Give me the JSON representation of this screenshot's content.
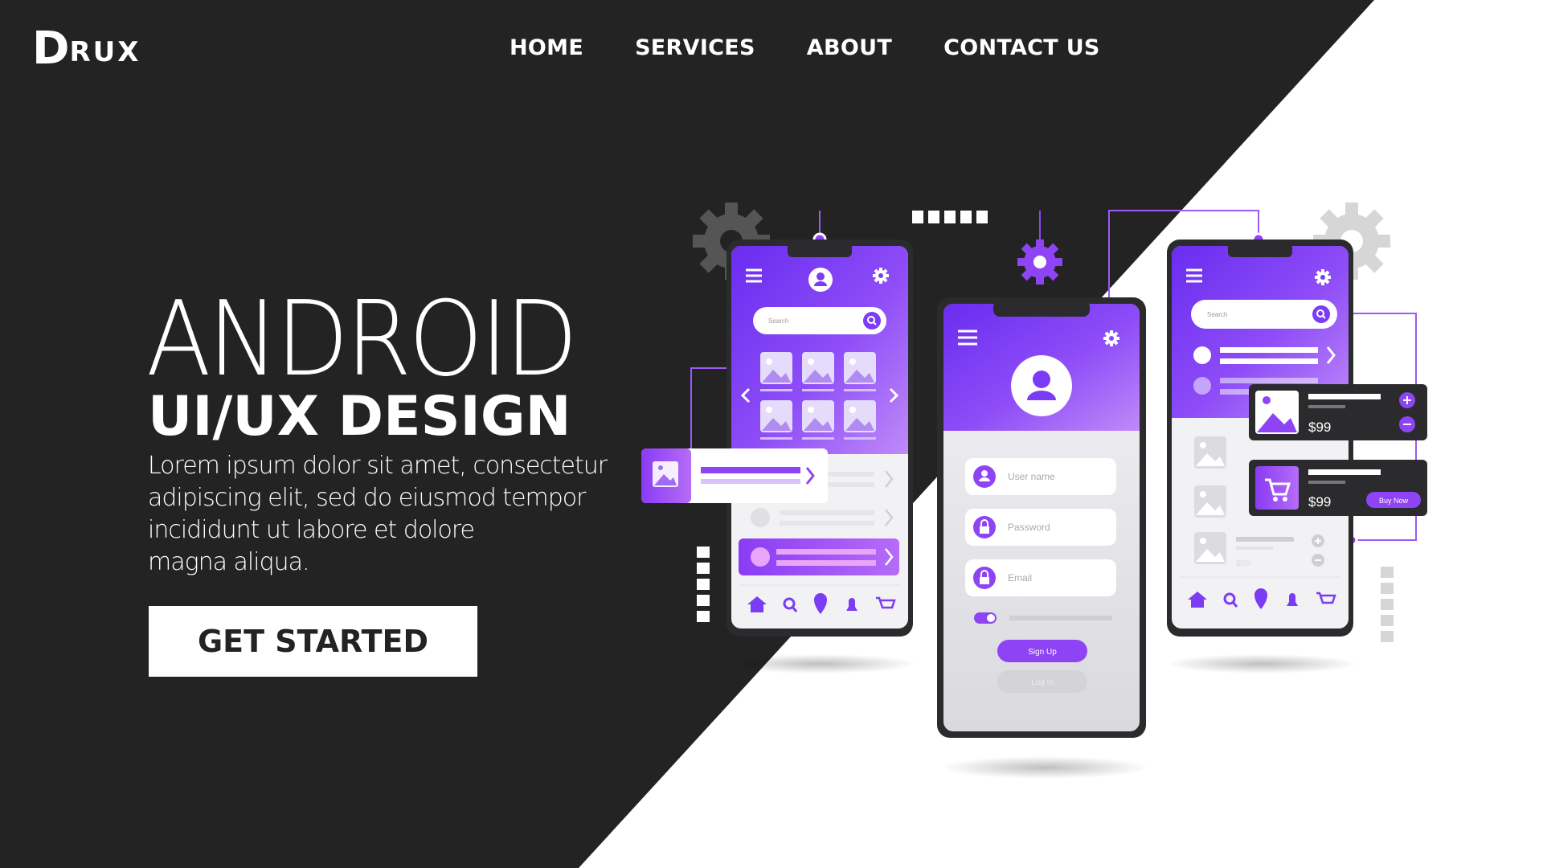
{
  "brand": {
    "logo_initial": "D",
    "logo_rest": "RUX"
  },
  "nav": {
    "items": [
      "HOME",
      "SERVICES",
      "ABOUT",
      "CONTACT US"
    ]
  },
  "hero": {
    "title": "ANDROID",
    "subtitle": "UI/UX DESIGN",
    "body_lines": [
      "Lorem ipsum dolor sit amet, consectetur",
      "adipiscing elit, sed do eiusmod tempor",
      "incididunt ut labore et dolore",
      "magna aliqua."
    ],
    "cta": "GET STARTED"
  },
  "phones": {
    "left": {
      "search_placeholder": "Search"
    },
    "middle": {
      "username_placeholder": "User name",
      "password_placeholder": "Password",
      "email_placeholder": "Email",
      "signup_label": "Sign Up",
      "login_label": "Log In"
    },
    "right": {
      "search_placeholder": "Search",
      "card1_price": "$99",
      "card2_price": "$99",
      "buy_label": "Buy Now",
      "list_price": "$99"
    }
  },
  "colors": {
    "dark": "#232323",
    "accent": "#7b3cf5",
    "accent_light": "#b56cf7",
    "white": "#ffffff"
  },
  "icons": [
    "menu-icon",
    "user-icon",
    "gear-icon",
    "search-icon",
    "image-icon",
    "chevron-right-icon",
    "chevron-left-icon",
    "home-icon",
    "location-icon",
    "bell-icon",
    "cart-icon",
    "lock-icon",
    "plus-icon",
    "minus-icon"
  ]
}
